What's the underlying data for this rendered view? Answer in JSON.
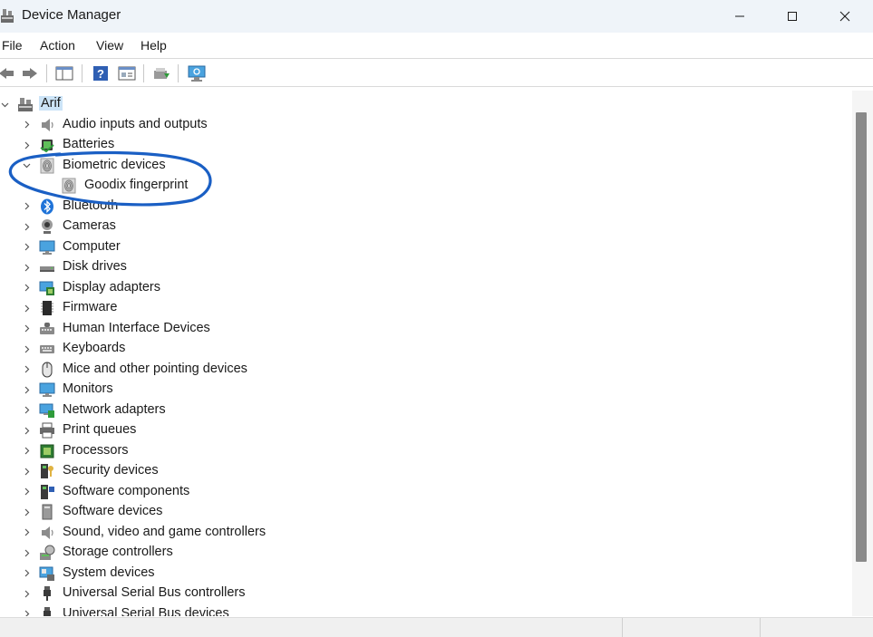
{
  "window": {
    "title": "Device Manager",
    "icon": "device-manager-icon",
    "controls": {
      "minimize": "—",
      "maximize": "☐",
      "close": "✕"
    }
  },
  "menu": [
    "File",
    "Action",
    "View",
    "Help"
  ],
  "toolbar": {
    "buttons": [
      "back-icon",
      "forward-icon",
      "show-hide-console-tree-icon",
      "help-icon",
      "properties-icon",
      "update-driver-icon",
      "scan-hardware-icon"
    ]
  },
  "tree": {
    "root": {
      "label": "Arif",
      "icon": "computer-icon",
      "expanded": true,
      "selected": true
    },
    "categories": [
      {
        "label": "Audio inputs and outputs",
        "icon": "speaker-icon",
        "expanded": false
      },
      {
        "label": "Batteries",
        "icon": "battery-icon",
        "expanded": false
      },
      {
        "label": "Biometric devices",
        "icon": "fingerprint-icon",
        "expanded": true,
        "children": [
          {
            "label": "Goodix fingerprint",
            "icon": "fingerprint-icon"
          }
        ]
      },
      {
        "label": "Bluetooth",
        "icon": "bluetooth-icon",
        "expanded": false
      },
      {
        "label": "Cameras",
        "icon": "camera-icon",
        "expanded": false
      },
      {
        "label": "Computer",
        "icon": "monitor-icon",
        "expanded": false
      },
      {
        "label": "Disk drives",
        "icon": "disk-drive-icon",
        "expanded": false
      },
      {
        "label": "Display adapters",
        "icon": "display-adapter-icon",
        "expanded": false
      },
      {
        "label": "Firmware",
        "icon": "firmware-chip-icon",
        "expanded": false
      },
      {
        "label": "Human Interface Devices",
        "icon": "hid-icon",
        "expanded": false
      },
      {
        "label": "Keyboards",
        "icon": "keyboard-icon",
        "expanded": false
      },
      {
        "label": "Mice and other pointing devices",
        "icon": "mouse-icon",
        "expanded": false
      },
      {
        "label": "Monitors",
        "icon": "monitor-icon",
        "expanded": false
      },
      {
        "label": "Network adapters",
        "icon": "network-adapter-icon",
        "expanded": false
      },
      {
        "label": "Print queues",
        "icon": "printer-icon",
        "expanded": false
      },
      {
        "label": "Processors",
        "icon": "processor-icon",
        "expanded": false
      },
      {
        "label": "Security devices",
        "icon": "security-device-icon",
        "expanded": false
      },
      {
        "label": "Software components",
        "icon": "software-component-icon",
        "expanded": false
      },
      {
        "label": "Software devices",
        "icon": "software-device-icon",
        "expanded": false
      },
      {
        "label": "Sound, video and game controllers",
        "icon": "speaker-icon",
        "expanded": false
      },
      {
        "label": "Storage controllers",
        "icon": "storage-controller-icon",
        "expanded": false
      },
      {
        "label": "System devices",
        "icon": "system-device-icon",
        "expanded": false
      },
      {
        "label": "Universal Serial Bus controllers",
        "icon": "usb-icon",
        "expanded": false
      },
      {
        "label": "Universal Serial Bus devices",
        "icon": "usb-icon",
        "expanded": false
      }
    ]
  },
  "annotation": {
    "color": "#1a5fc4",
    "note": "hand-drawn blue circle around Biometric devices"
  }
}
